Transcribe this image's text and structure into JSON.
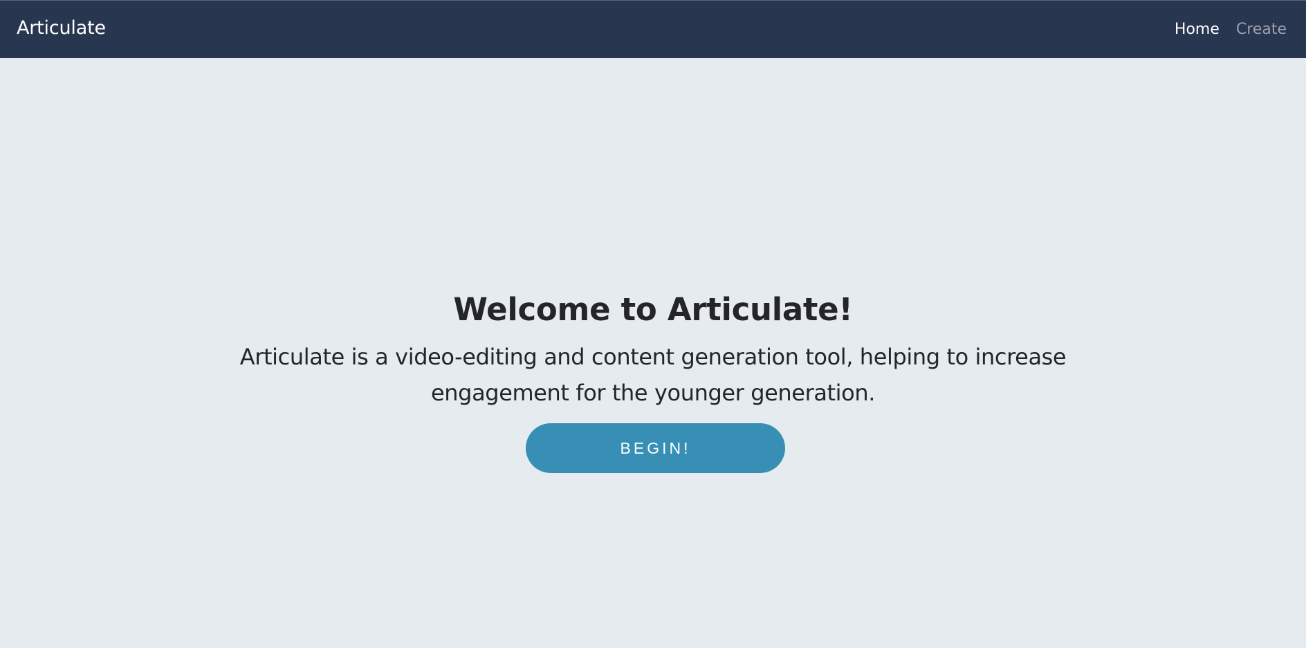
{
  "navbar": {
    "brand": "Articulate",
    "links": [
      {
        "label": "Home",
        "active": true
      },
      {
        "label": "Create",
        "active": false
      }
    ]
  },
  "hero": {
    "title": "Welcome to Articulate!",
    "description": "Articulate is a video-editing and content generation tool, helping to increase engagement for the younger generation.",
    "button_label": "BEGIN!"
  },
  "colors": {
    "navbar_bg": "#29364f",
    "page_bg": "#e6ebf0",
    "button_bg": "#378fb5",
    "text_dark": "#23252b",
    "nav_inactive": "#9aa1ad"
  }
}
